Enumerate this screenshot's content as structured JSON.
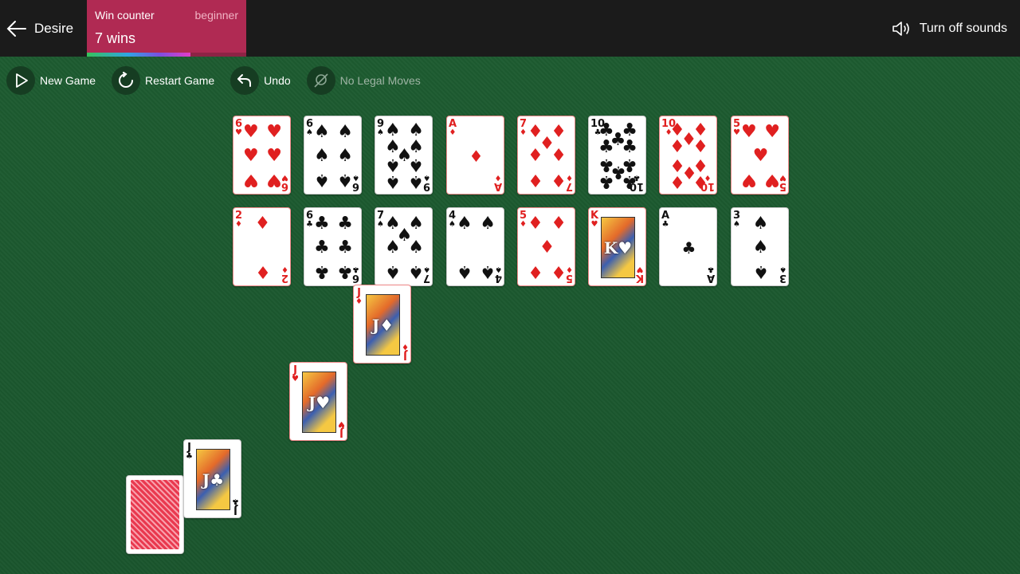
{
  "header": {
    "back_label": "Desire",
    "win_counter_title": "Win counter",
    "level": "beginner",
    "win_count": "7 wins",
    "win_progress": 0.65,
    "sound_label": "Turn off sounds"
  },
  "toolbar": {
    "new_game": "New Game",
    "restart": "Restart Game",
    "undo": "Undo",
    "no_moves": "No Legal Moves"
  },
  "cards": {
    "row1": [
      {
        "rank": "6",
        "suit": "♥",
        "color": "red"
      },
      {
        "rank": "6",
        "suit": "♠",
        "color": "black"
      },
      {
        "rank": "9",
        "suit": "♠",
        "color": "black"
      },
      {
        "rank": "A",
        "suit": "♦",
        "color": "red"
      },
      {
        "rank": "7",
        "suit": "♦",
        "color": "red"
      },
      {
        "rank": "10",
        "suit": "♣",
        "color": "black"
      },
      {
        "rank": "10",
        "suit": "♦",
        "color": "red"
      },
      {
        "rank": "5",
        "suit": "♥",
        "color": "red"
      }
    ],
    "row2": [
      {
        "rank": "2",
        "suit": "♦",
        "color": "red"
      },
      {
        "rank": "6",
        "suit": "♣",
        "color": "black"
      },
      {
        "rank": "7",
        "suit": "♠",
        "color": "black"
      },
      {
        "rank": "4",
        "suit": "♠",
        "color": "black"
      },
      {
        "rank": "5",
        "suit": "♦",
        "color": "red"
      },
      {
        "rank": "K",
        "suit": "♥",
        "color": "red"
      },
      {
        "rank": "A",
        "suit": "♣",
        "color": "black"
      },
      {
        "rank": "3",
        "suit": "♠",
        "color": "black"
      }
    ],
    "waste": [
      {
        "rank": "J",
        "suit": "♦",
        "color": "red"
      },
      {
        "rank": "J",
        "suit": "♥",
        "color": "red"
      },
      {
        "rank": "J",
        "suit": "♣",
        "color": "black"
      }
    ]
  },
  "colors": {
    "felt": "#1c5a2f",
    "header": "#1b1b1b",
    "win_counter": "#b02a53",
    "card_red": "#e02020",
    "card_black": "#111111"
  }
}
